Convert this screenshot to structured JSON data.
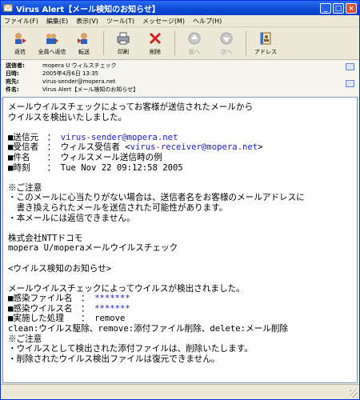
{
  "window": {
    "title": "Virus Alert【メール検知のお知らせ】"
  },
  "menu": [
    "ファイル(F)",
    "編集(E)",
    "表示(V)",
    "ツール(T)",
    "メッセージ(M)",
    "ヘルプ(H)"
  ],
  "toolbar": [
    {
      "label": "返信",
      "icon": "reply-icon",
      "enabled": true
    },
    {
      "label": "全員へ返信",
      "icon": "reply-all-icon",
      "enabled": true
    },
    {
      "label": "転送",
      "icon": "forward-icon",
      "enabled": true
    },
    {
      "label": "印刷",
      "icon": "print-icon",
      "enabled": true
    },
    {
      "label": "削除",
      "icon": "delete-icon",
      "enabled": true
    },
    {
      "label": "前へ",
      "icon": "previous-icon",
      "enabled": false
    },
    {
      "label": "次へ",
      "icon": "next-icon",
      "enabled": false
    },
    {
      "label": "アドレス",
      "icon": "address-book-icon",
      "enabled": true
    }
  ],
  "header": {
    "from_label": "送信者:",
    "from": "mopera U ウィルスチェック",
    "date_label": "日時:",
    "date": "2005年4月6日 13:35",
    "to_label": "宛先:",
    "to": "virus-sender@mopera.net",
    "subject_label": "件名:",
    "subject": "Virus Alert【メール検知のお知らせ】"
  },
  "body": {
    "intro1": "メールウイルスチェックによってお客様が送信されたメールから",
    "intro2": "ウイルスを検出いたしました。",
    "sender_label": "■送信元　：",
    "sender": "virus-sender@mopera.net",
    "recipient_label": "■受信者　： ウィルス受信者 <",
    "recipient": "virus-receiver@mopera.net",
    "recipient_close": ">",
    "subject_line": "■件名　　： ウィルスメール送信時の例",
    "time_line": "■時刻　　： Tue Nov 22 09:12:58 2005",
    "note_heading": "※ご注意",
    "note1a": "・このメールに心当たりがない場合は、送信者名をお客様のメールアドレスに",
    "note1b": "　書き換えられたメールを送信された可能性があります。",
    "note2": "・本メールには返信できません。",
    "company": "株式会社NTTドコモ",
    "service": "mopera U/moperaメールウイルスチェック",
    "notice_title": "<ウイルス検知のお知らせ>",
    "detected": "メールウイルスチェックによってウイルスが検出されました。",
    "file_label": "■感染ファイル名　：",
    "file_value": "*******",
    "virus_label": "■感染ウイルス名　：",
    "virus_value": "*******",
    "action_line": "■実施した処理　　： remove",
    "legend": "clean:ウイルス駆除、remove:添付ファイル削除、delete:メール削除",
    "note_heading2": "※ご注意",
    "note3": "・ウイルスとして検出された添付ファイルは、削除いたします。",
    "note4": "・削除されたウイルス検出ファイルは復元できません。"
  }
}
